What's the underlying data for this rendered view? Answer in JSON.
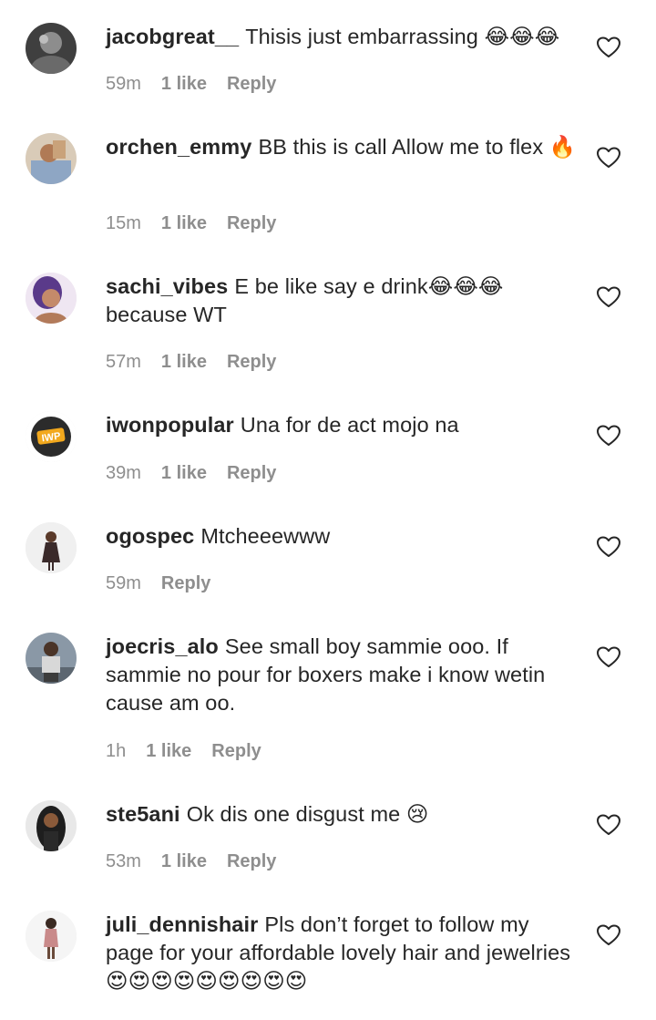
{
  "comments": [
    {
      "username": "jacobgreat__",
      "text": "Thisis just embarrassing 😂😂😂",
      "time": "59m",
      "likes": "1 like",
      "reply": "Reply",
      "avatar_colors": [
        "#4a4a4a",
        "#9a9a9a"
      ]
    },
    {
      "username": "orchen_emmy",
      "text": "BB this is call Allow me to flex 🔥",
      "time": "15m",
      "likes": "1 like",
      "reply": "Reply",
      "avatar_colors": [
        "#c9a27a",
        "#8ea6c4"
      ]
    },
    {
      "username": "sachi_vibes",
      "text": "E be like say e drink😂😂😂 because WT",
      "time": "57m",
      "likes": "1 like",
      "reply": "Reply",
      "avatar_colors": [
        "#5a3a8a",
        "#c48a6a"
      ]
    },
    {
      "username": "iwonpopular",
      "text": "Una for de act mojo na",
      "time": "39m",
      "likes": "1 like",
      "reply": "Reply",
      "avatar_colors": [
        "#f2a81d",
        "#2b2b2b"
      ],
      "avatar_logo_text": "IWP"
    },
    {
      "username": "ogospec",
      "text": "Mtcheeewww",
      "time": "59m",
      "likes": "",
      "reply": "Reply",
      "avatar_colors": [
        "#f0f0f0",
        "#3a2a2a"
      ]
    },
    {
      "username": "joecris_alo",
      "text": "See small boy sammie ooo. If sammie no pour for boxers make i know wetin cause am oo.",
      "time": "1h",
      "likes": "1 like",
      "reply": "Reply",
      "avatar_colors": [
        "#6d7b8a",
        "#3c3c3c"
      ]
    },
    {
      "username": "ste5ani",
      "text": "Ok dis one disgust me 😢",
      "time": "53m",
      "likes": "1 like",
      "reply": "Reply",
      "avatar_colors": [
        "#e8e8e8",
        "#1e1e1e"
      ]
    },
    {
      "username": "juli_dennishair",
      "text": "Pls don’t forget to follow my page for your affordable lovely hair and jewelries 😍😍😍😍😍😍😍😍😍",
      "time": "",
      "likes": "",
      "reply": "",
      "avatar_colors": [
        "#f5f5f5",
        "#c98a8a"
      ]
    }
  ],
  "colors": {
    "text": "#262626",
    "meta": "#8e8e8e",
    "heart_stroke": "#262626"
  },
  "icons": {
    "like": "heart-outline-icon"
  }
}
